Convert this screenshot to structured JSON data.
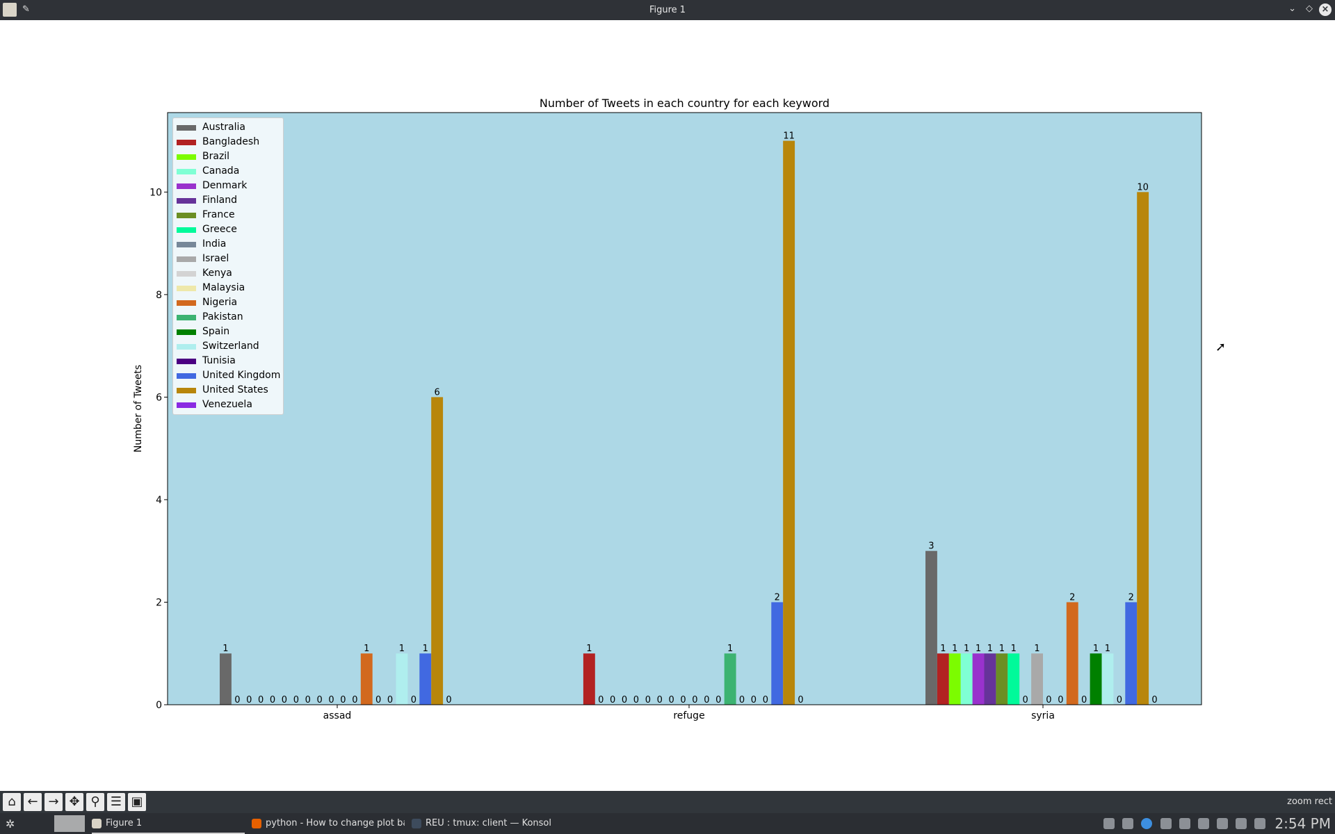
{
  "window": {
    "title": "Figure 1",
    "pin_icon": "pin-icon",
    "minimize_icon": "chevron-down-icon",
    "maximize_icon": "diamond-icon",
    "close_icon": "close-icon"
  },
  "chart_data": {
    "type": "bar",
    "title": "Number of Tweets in each country for each keyword",
    "xlabel": "",
    "ylabel": "Number of Tweets",
    "categories": [
      "assad",
      "refuge",
      "syria"
    ],
    "ylim": [
      0,
      11.55
    ],
    "yticks": [
      "0",
      "2",
      "4",
      "6",
      "8",
      "10"
    ],
    "background": "#add8e6",
    "legend_position": "upper-left",
    "grid": false,
    "series": [
      {
        "name": "Australia",
        "color": "#696969",
        "values": [
          1,
          null,
          3
        ]
      },
      {
        "name": "Bangladesh",
        "color": "#b22222",
        "values": [
          0,
          1,
          1
        ]
      },
      {
        "name": "Brazil",
        "color": "#7cfc00",
        "values": [
          0,
          0,
          1
        ]
      },
      {
        "name": "Canada",
        "color": "#7fffd4",
        "values": [
          0,
          0,
          1
        ]
      },
      {
        "name": "Denmark",
        "color": "#9932cc",
        "values": [
          0,
          0,
          1
        ]
      },
      {
        "name": "Finland",
        "color": "#663399",
        "values": [
          0,
          0,
          1
        ]
      },
      {
        "name": "France",
        "color": "#6b8e23",
        "values": [
          0,
          0,
          1
        ]
      },
      {
        "name": "Greece",
        "color": "#00fa9a",
        "values": [
          0,
          0,
          1
        ]
      },
      {
        "name": "India",
        "color": "#778899",
        "values": [
          0,
          0,
          0
        ]
      },
      {
        "name": "Israel",
        "color": "#a9a9a9",
        "values": [
          0,
          0,
          1
        ]
      },
      {
        "name": "Kenya",
        "color": "#d3d3d3",
        "values": [
          0,
          0,
          0
        ]
      },
      {
        "name": "Malaysia",
        "color": "#eee8aa",
        "values": [
          0,
          0,
          0
        ]
      },
      {
        "name": "Nigeria",
        "color": "#d2691e",
        "values": [
          1,
          0,
          2
        ]
      },
      {
        "name": "Pakistan",
        "color": "#3cb371",
        "values": [
          0,
          1,
          0
        ]
      },
      {
        "name": "Spain",
        "color": "#008000",
        "values": [
          0,
          0,
          1
        ]
      },
      {
        "name": "Switzerland",
        "color": "#afeeee",
        "values": [
          1,
          0,
          1
        ]
      },
      {
        "name": "Tunisia",
        "color": "#4b0082",
        "values": [
          0,
          0,
          0
        ]
      },
      {
        "name": "United Kingdom",
        "color": "#4169e1",
        "values": [
          1,
          2,
          2
        ]
      },
      {
        "name": "United States",
        "color": "#b8860b",
        "values": [
          6,
          11,
          10
        ]
      },
      {
        "name": "Venezuela",
        "color": "#8a2be2",
        "values": [
          0,
          0,
          0
        ]
      }
    ]
  },
  "toolbar": {
    "buttons": [
      {
        "name": "home-icon",
        "glyph": "⌂"
      },
      {
        "name": "back-arrow-icon",
        "glyph": "←"
      },
      {
        "name": "forward-arrow-icon",
        "glyph": "→"
      },
      {
        "name": "pan-icon",
        "glyph": "✥"
      },
      {
        "name": "zoom-icon",
        "glyph": "⚲"
      },
      {
        "name": "configure-subplots-icon",
        "glyph": "☰"
      },
      {
        "name": "save-icon",
        "glyph": "▣"
      }
    ],
    "status": "zoom rect"
  },
  "taskbar": {
    "items": [
      {
        "label": "Figure 1",
        "icon": "matplotlib-icon",
        "color": "#d9d4c7",
        "active": true
      },
      {
        "label": "python - How to change plot ba...",
        "icon": "firefox-icon",
        "color": "#e66000",
        "active": false
      },
      {
        "label": "REU : tmux: client — Konsole",
        "icon": "konsole-icon",
        "color": "#3d4b5c",
        "active": false
      }
    ],
    "clock": "2:54 PM"
  }
}
